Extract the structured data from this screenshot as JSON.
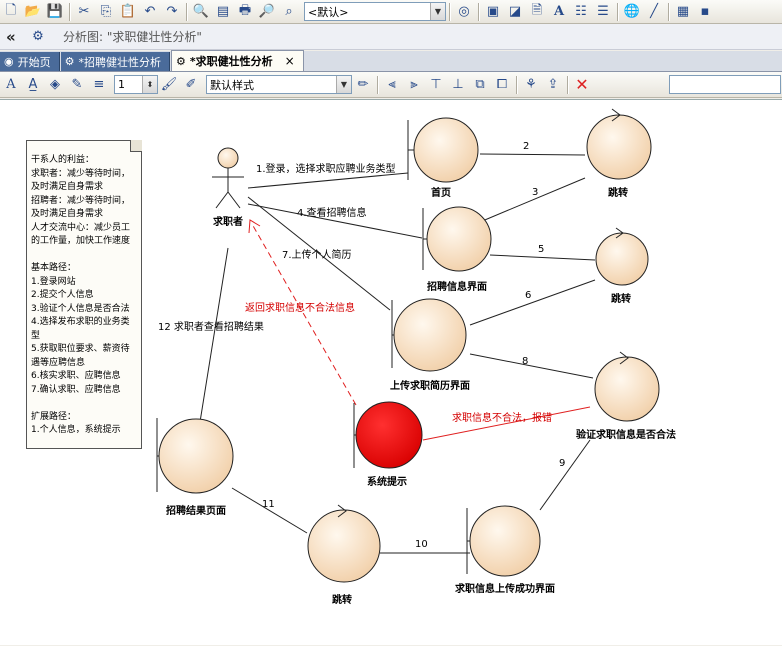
{
  "toolbar_top": {
    "style_combo": "<默认>"
  },
  "nav_bar": {
    "back_glyph": "«",
    "diagram_title": "分析图: \"求职健壮性分析\""
  },
  "tabs": [
    {
      "label": "开始页",
      "active": false
    },
    {
      "label": "*招聘健壮性分析",
      "active": false
    },
    {
      "label": "*求职健壮性分析",
      "active": true,
      "close": "×"
    }
  ],
  "format_bar": {
    "line_width": "1",
    "style_combo": "默认样式"
  },
  "note": {
    "lines": [
      "干系人的利益：",
      "求职者：减少等待时间，",
      "及时满足自身需求",
      "招聘者：减少等待时间，",
      "及时满足自身需求",
      "人才交流中心：减少员工",
      "的工作量，加快工作速度",
      "",
      "基本路径：",
      "1.登录网站",
      "2.提交个人信息",
      "3.验证个人信息是否合法",
      "4.选择发布求职的业务类",
      "型",
      "5.获取职位要求、薪资待",
      "遇等应聘信息",
      "6.核实求职、应聘信息",
      "7.确认求职、应聘信息",
      "",
      "扩展路径：",
      "1.个人信息，系统提示"
    ]
  },
  "actor": {
    "label": "求职者"
  },
  "nodes": {
    "homepage": "首页",
    "jump1": "跳转",
    "recruit_info": "招聘信息界面",
    "jump2": "跳转",
    "upload_resume": "上传求职简历界面",
    "validate": "验证求职信息是否合法",
    "system_prompt": "系统提示",
    "result_page": "招聘结果页面",
    "jump3": "跳转",
    "upload_success": "求职信息上传成功界面"
  },
  "messages": {
    "m1": "1.登录，选择求职应聘业务类型",
    "m2": "2",
    "m3": "3",
    "m4": "4.查看招聘信息",
    "m5": "5",
    "m6": "6",
    "m7": "7.上传个人简历",
    "m8": "8",
    "m9": "9",
    "m10": "10",
    "m11": "11",
    "m12": "12 求职者查看招聘结果",
    "return_illegal": "返回求职信息不合法信息",
    "error_illegal": "求职信息不合法，报错"
  },
  "colors": {
    "node_fill": "#f8dcc0",
    "error_node": "#ff0000",
    "error_line": "#e02020",
    "canvas": "#ffffff"
  }
}
